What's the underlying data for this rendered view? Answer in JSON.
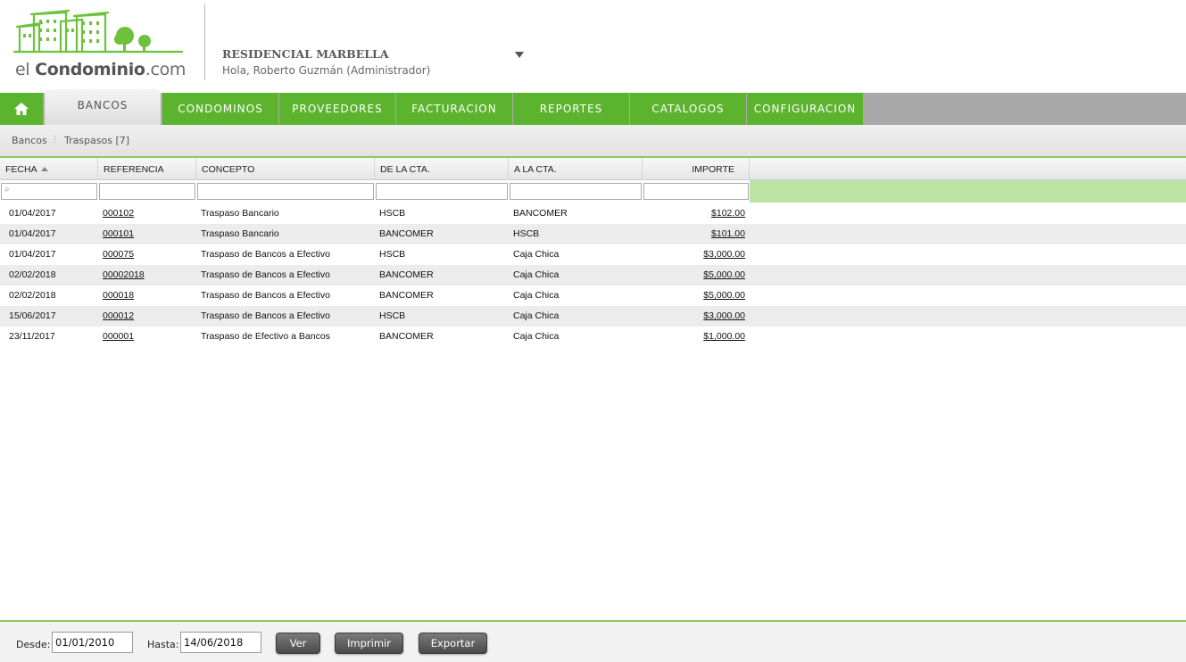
{
  "header": {
    "logo_prefix": "el ",
    "logo_brand": "Condominio",
    "logo_suffix": ".com",
    "condo_name": "RESIDENCIAL MARBELLA",
    "greeting": "Hola, Roberto Guzmán (Administrador)"
  },
  "nav": {
    "items": [
      {
        "label": "BANCOS"
      },
      {
        "label": "CONDOMINOS"
      },
      {
        "label": "PROVEEDORES"
      },
      {
        "label": "FACTURACION"
      },
      {
        "label": "REPORTES"
      },
      {
        "label": "CATALOGOS"
      },
      {
        "label": "CONFIGURACION"
      }
    ]
  },
  "breadcrumb": {
    "root": "Bancos",
    "current": "Traspasos [7]"
  },
  "grid": {
    "columns": [
      "FECHA",
      "REFERENCIA",
      "CONCEPTO",
      "DE LA CTA.",
      "A LA CTA.",
      "IMPORTE"
    ],
    "rows": [
      {
        "fecha": "01/04/2017",
        "referencia": "000102",
        "concepto": "Traspaso Bancario",
        "de": "HSCB",
        "a": "BANCOMER",
        "importe": "$102.00"
      },
      {
        "fecha": "01/04/2017",
        "referencia": "000101",
        "concepto": "Traspaso Bancario",
        "de": "BANCOMER",
        "a": "HSCB",
        "importe": "$101.00"
      },
      {
        "fecha": "01/04/2017",
        "referencia": "000075",
        "concepto": "Traspaso de Bancos a Efectivo",
        "de": "HSCB",
        "a": "Caja Chica",
        "importe": "$3,000.00"
      },
      {
        "fecha": "02/02/2018",
        "referencia": "00002018",
        "concepto": "Traspaso de Bancos a Efectivo",
        "de": "BANCOMER",
        "a": "Caja Chica",
        "importe": "$5,000.00"
      },
      {
        "fecha": "02/02/2018",
        "referencia": "000018",
        "concepto": "Traspaso de Bancos a Efectivo",
        "de": "BANCOMER",
        "a": "Caja Chica",
        "importe": "$5,000.00"
      },
      {
        "fecha": "15/06/2017",
        "referencia": "000012",
        "concepto": "Traspaso de Bancos a Efectivo",
        "de": "HSCB",
        "a": "Caja Chica",
        "importe": "$3,000.00"
      },
      {
        "fecha": "23/11/2017",
        "referencia": "000001",
        "concepto": "Traspaso de Efectivo a Bancos",
        "de": "BANCOMER",
        "a": "Caja Chica",
        "importe": "$1,000.00"
      }
    ]
  },
  "footer": {
    "desde_label": "Desde:",
    "desde_value": "01/01/2010",
    "hasta_label": "Hasta:",
    "hasta_value": "14/06/2018",
    "ver_label": "Ver",
    "imprimir_label": "Imprimir",
    "exportar_label": "Exportar"
  },
  "colors": {
    "brand_green": "#5cb42e",
    "filter_green": "#bde3a2",
    "nav_gray": "#a9a9a9"
  },
  "icons": {
    "home": "home-icon",
    "dropdown": "chevron-down-icon",
    "filter": "search-icon"
  }
}
